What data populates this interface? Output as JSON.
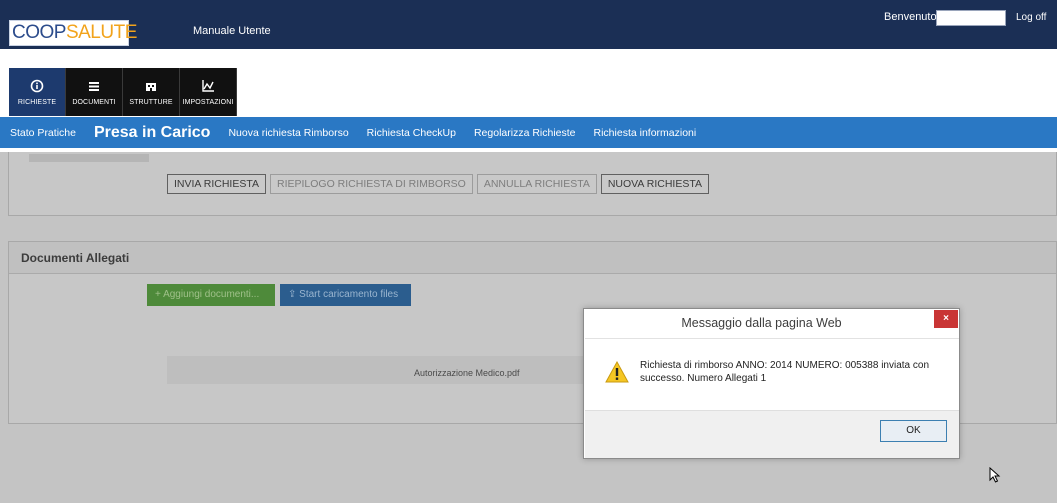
{
  "header": {
    "logo_part1": "COOP",
    "logo_part2": "SALUTE",
    "manual_link": "Manuale Utente",
    "welcome_label": "Benvenuto",
    "logoff": "Log off"
  },
  "icon_tabs": [
    {
      "label": "RICHIESTE",
      "icon": "info-icon",
      "active": true
    },
    {
      "label": "DOCUMENTI",
      "icon": "list-icon",
      "active": false
    },
    {
      "label": "STRUTTURE",
      "icon": "building-icon",
      "active": false
    },
    {
      "label": "IMPOSTAZIONI",
      "icon": "chart-icon",
      "active": false
    }
  ],
  "nav": {
    "stato_pratiche": "Stato Pratiche",
    "presa_in_carico": "Presa in Carico",
    "nuova_richiesta": "Nuova richiesta Rimborso",
    "checkup": "Richiesta CheckUp",
    "regolarizza": "Regolarizza Richieste",
    "informazioni": "Richiesta informazioni"
  },
  "actions": {
    "invia": "INVIA RICHIESTA",
    "riepilogo": "RIEPILOGO RICHIESTA DI RIMBORSO",
    "annulla": "ANNULLA RICHIESTA",
    "nuova": "NUOVA RICHIESTA"
  },
  "documents": {
    "title": "Documenti Allegati",
    "add_button": "+ Aggiungi documenti...",
    "upload_button": "Start caricamento files",
    "file_name": "Autorizzazione Medico.pdf"
  },
  "dialog": {
    "title": "Messaggio dalla pagina Web",
    "close": "×",
    "message": "Richiesta di rimborso ANNO: 2014 NUMERO: 005388 inviata con successo. Numero Allegati 1",
    "ok": "OK"
  },
  "colors": {
    "topbar": "#1b2f55",
    "navbar": "#2a78c4",
    "accent_orange": "#f2a31b",
    "close_red": "#c93535"
  }
}
